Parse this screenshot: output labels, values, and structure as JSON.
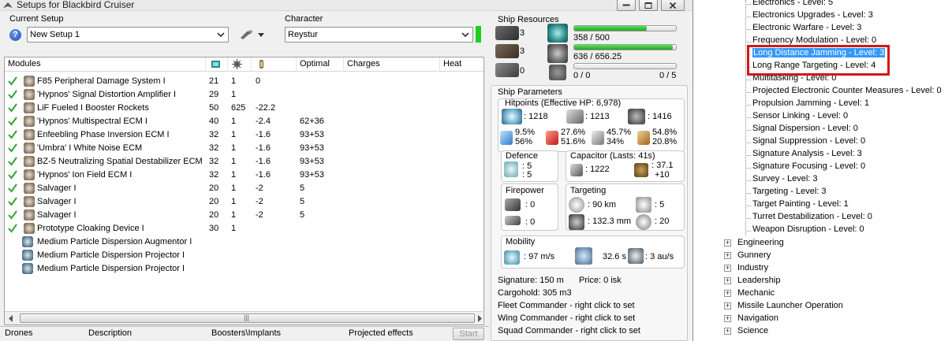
{
  "window": {
    "title": "Setups for Blackbird Cruiser"
  },
  "setup": {
    "label": "Current Setup",
    "value": "New Setup 1"
  },
  "character": {
    "label": "Character",
    "value": "Reystur"
  },
  "modules": {
    "headers": [
      "Modules",
      "Optimal",
      "Charges",
      "Heat"
    ],
    "rows": [
      {
        "name": "F85 Peripheral Damage System I",
        "cpu": "21",
        "pg": "1",
        "cap": "0",
        "optimal": ""
      },
      {
        "name": "'Hypnos' Signal Distortion Amplifier I",
        "cpu": "29",
        "pg": "1",
        "cap": "",
        "optimal": ""
      },
      {
        "name": "LiF Fueled I Booster Rockets",
        "cpu": "50",
        "pg": "625",
        "cap": "-22.2",
        "optimal": ""
      },
      {
        "name": "'Hypnos' Multispectral ECM I",
        "cpu": "40",
        "pg": "1",
        "cap": "-2.4",
        "optimal": "62+36"
      },
      {
        "name": "Enfeebling Phase Inversion ECM I",
        "cpu": "32",
        "pg": "1",
        "cap": "-1.6",
        "optimal": "93+53"
      },
      {
        "name": "'Umbra' I White Noise ECM",
        "cpu": "32",
        "pg": "1",
        "cap": "-1.6",
        "optimal": "93+53"
      },
      {
        "name": "BZ-5 Neutralizing Spatial Destabilizer ECM",
        "cpu": "32",
        "pg": "1",
        "cap": "-1.6",
        "optimal": "93+53"
      },
      {
        "name": "'Hypnos' Ion Field ECM I",
        "cpu": "32",
        "pg": "1",
        "cap": "-1.6",
        "optimal": "93+53"
      },
      {
        "name": "Salvager I",
        "cpu": "20",
        "pg": "1",
        "cap": "-2",
        "optimal": "5"
      },
      {
        "name": "Salvager I",
        "cpu": "20",
        "pg": "1",
        "cap": "-2",
        "optimal": "5"
      },
      {
        "name": "Salvager I",
        "cpu": "20",
        "pg": "1",
        "cap": "-2",
        "optimal": "5"
      },
      {
        "name": "Prototype Cloaking Device I",
        "cpu": "30",
        "pg": "1",
        "cap": "",
        "optimal": ""
      },
      {
        "name": "Medium Particle Dispersion Augmentor I",
        "cpu": "",
        "pg": "",
        "cap": "",
        "optimal": ""
      },
      {
        "name": "Medium Particle Dispersion Projector I",
        "cpu": "",
        "pg": "",
        "cap": "",
        "optimal": ""
      },
      {
        "name": "Medium Particle Dispersion Projector I",
        "cpu": "",
        "pg": "",
        "cap": "",
        "optimal": ""
      }
    ]
  },
  "bottom_tabs": [
    "Drones",
    "Description",
    "Boosters\\Implants",
    "Projected effects"
  ],
  "bottom_button": "Start",
  "resources": {
    "label": "Ship Resources",
    "hi": "3",
    "mid": "3",
    "low": "0",
    "cpu": "358 / 500",
    "cpu_frac": 0.716,
    "pg": "636 / 656.25",
    "pg_frac": 0.969,
    "calib": "0 / 0",
    "drones": "0 / 5"
  },
  "params": {
    "label": "Ship Parameters",
    "hp_label": "Hitpoints (Effective HP: 6,978)",
    "shield": ": 1218",
    "armor": ": 1213",
    "structure": ": 1416",
    "res1": "9.5%",
    "res1b": "56%",
    "res2": "27.6%",
    "res2b": "51.6%",
    "res3": "45.7%",
    "res3b": "34%",
    "res4": "54.8%",
    "res4b": "20.8%",
    "defence_label": "Defence",
    "def1": ": 5",
    "def2": ": 5",
    "cap_label": "Capacitor (Lasts: 41s)",
    "cap_amount": ": 1222",
    "cap_rate": ": 37.1",
    "cap_rate2": "+10",
    "fire_label": "Firepower",
    "fire1": ": 0",
    "fire2": ": 0",
    "target_label": "Targeting",
    "range": ": 90 km",
    "maxtgt": ": 5",
    "scanres": ": 132.3 mm",
    "sensor": ": 20",
    "mob_label": "Mobility",
    "speed": ": 97 m/s",
    "align": "32.6 s",
    "warp": ": 3 au/s",
    "signature": "Signature: 150 m",
    "price": "Price: 0 isk",
    "cargo": "Cargohold: 305 m3",
    "fleet": "Fleet Commander - right click to set",
    "wing": "Wing Commander - right click to set",
    "squad": "Squad Commander - right click to set"
  },
  "tree": {
    "skills": [
      "Electronics - Level: 5",
      "Electronics Upgrades - Level: 3",
      "Electronic Warfare - Level: 3",
      "Frequency Modulation - Level: 0",
      "Long Distance Jamming - Level: 3",
      "Long Range Targeting - Level: 4",
      "Multitasking - Level: 0",
      "Projected Electronic Counter Measures - Level: 0",
      "Propulsion Jamming - Level: 1",
      "Sensor Linking - Level: 0",
      "Signal Dispersion - Level: 0",
      "Signal Suppression - Level: 0",
      "Signature Analysis - Level: 3",
      "Signature Focusing - Level: 0",
      "Survey - Level: 3",
      "Targeting - Level: 3",
      "Target Painting - Level: 1",
      "Turret Destabilization - Level: 0",
      "Weapon Disruption - Level: 0"
    ],
    "groups": [
      "Engineering",
      "Gunnery",
      "Industry",
      "Leadership",
      "Mechanic",
      "Missile Launcher Operation",
      "Navigation",
      "Science"
    ]
  }
}
